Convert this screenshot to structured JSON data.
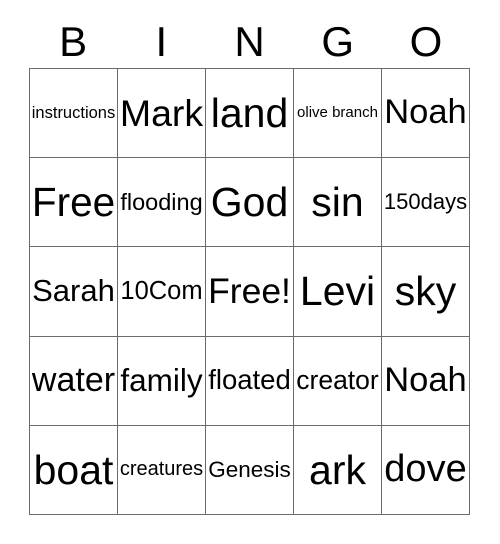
{
  "card": {
    "title": "BINGO",
    "header_letters": [
      "B",
      "I",
      "N",
      "G",
      "O"
    ],
    "grid_colors": {
      "border": "#6b6b6b",
      "background": "#ffffff",
      "text": "#000000"
    },
    "rows": [
      [
        {
          "text": "instructions"
        },
        {
          "text": "Mark"
        },
        {
          "text": "land"
        },
        {
          "text": "olive branch"
        },
        {
          "text": "Noah"
        }
      ],
      [
        {
          "text": "Free"
        },
        {
          "text": "flooding"
        },
        {
          "text": "God"
        },
        {
          "text": "sin"
        },
        {
          "text": "150days"
        }
      ],
      [
        {
          "text": "Sarah"
        },
        {
          "text": "10Com"
        },
        {
          "text": "Free!"
        },
        {
          "text": "Levi"
        },
        {
          "text": "sky"
        }
      ],
      [
        {
          "text": "water"
        },
        {
          "text": "family"
        },
        {
          "text": "floated"
        },
        {
          "text": "creator"
        },
        {
          "text": "Noah"
        }
      ],
      [
        {
          "text": "boat"
        },
        {
          "text": "creatures"
        },
        {
          "text": "Genesis"
        },
        {
          "text": "ark"
        },
        {
          "text": "dove"
        }
      ]
    ]
  }
}
